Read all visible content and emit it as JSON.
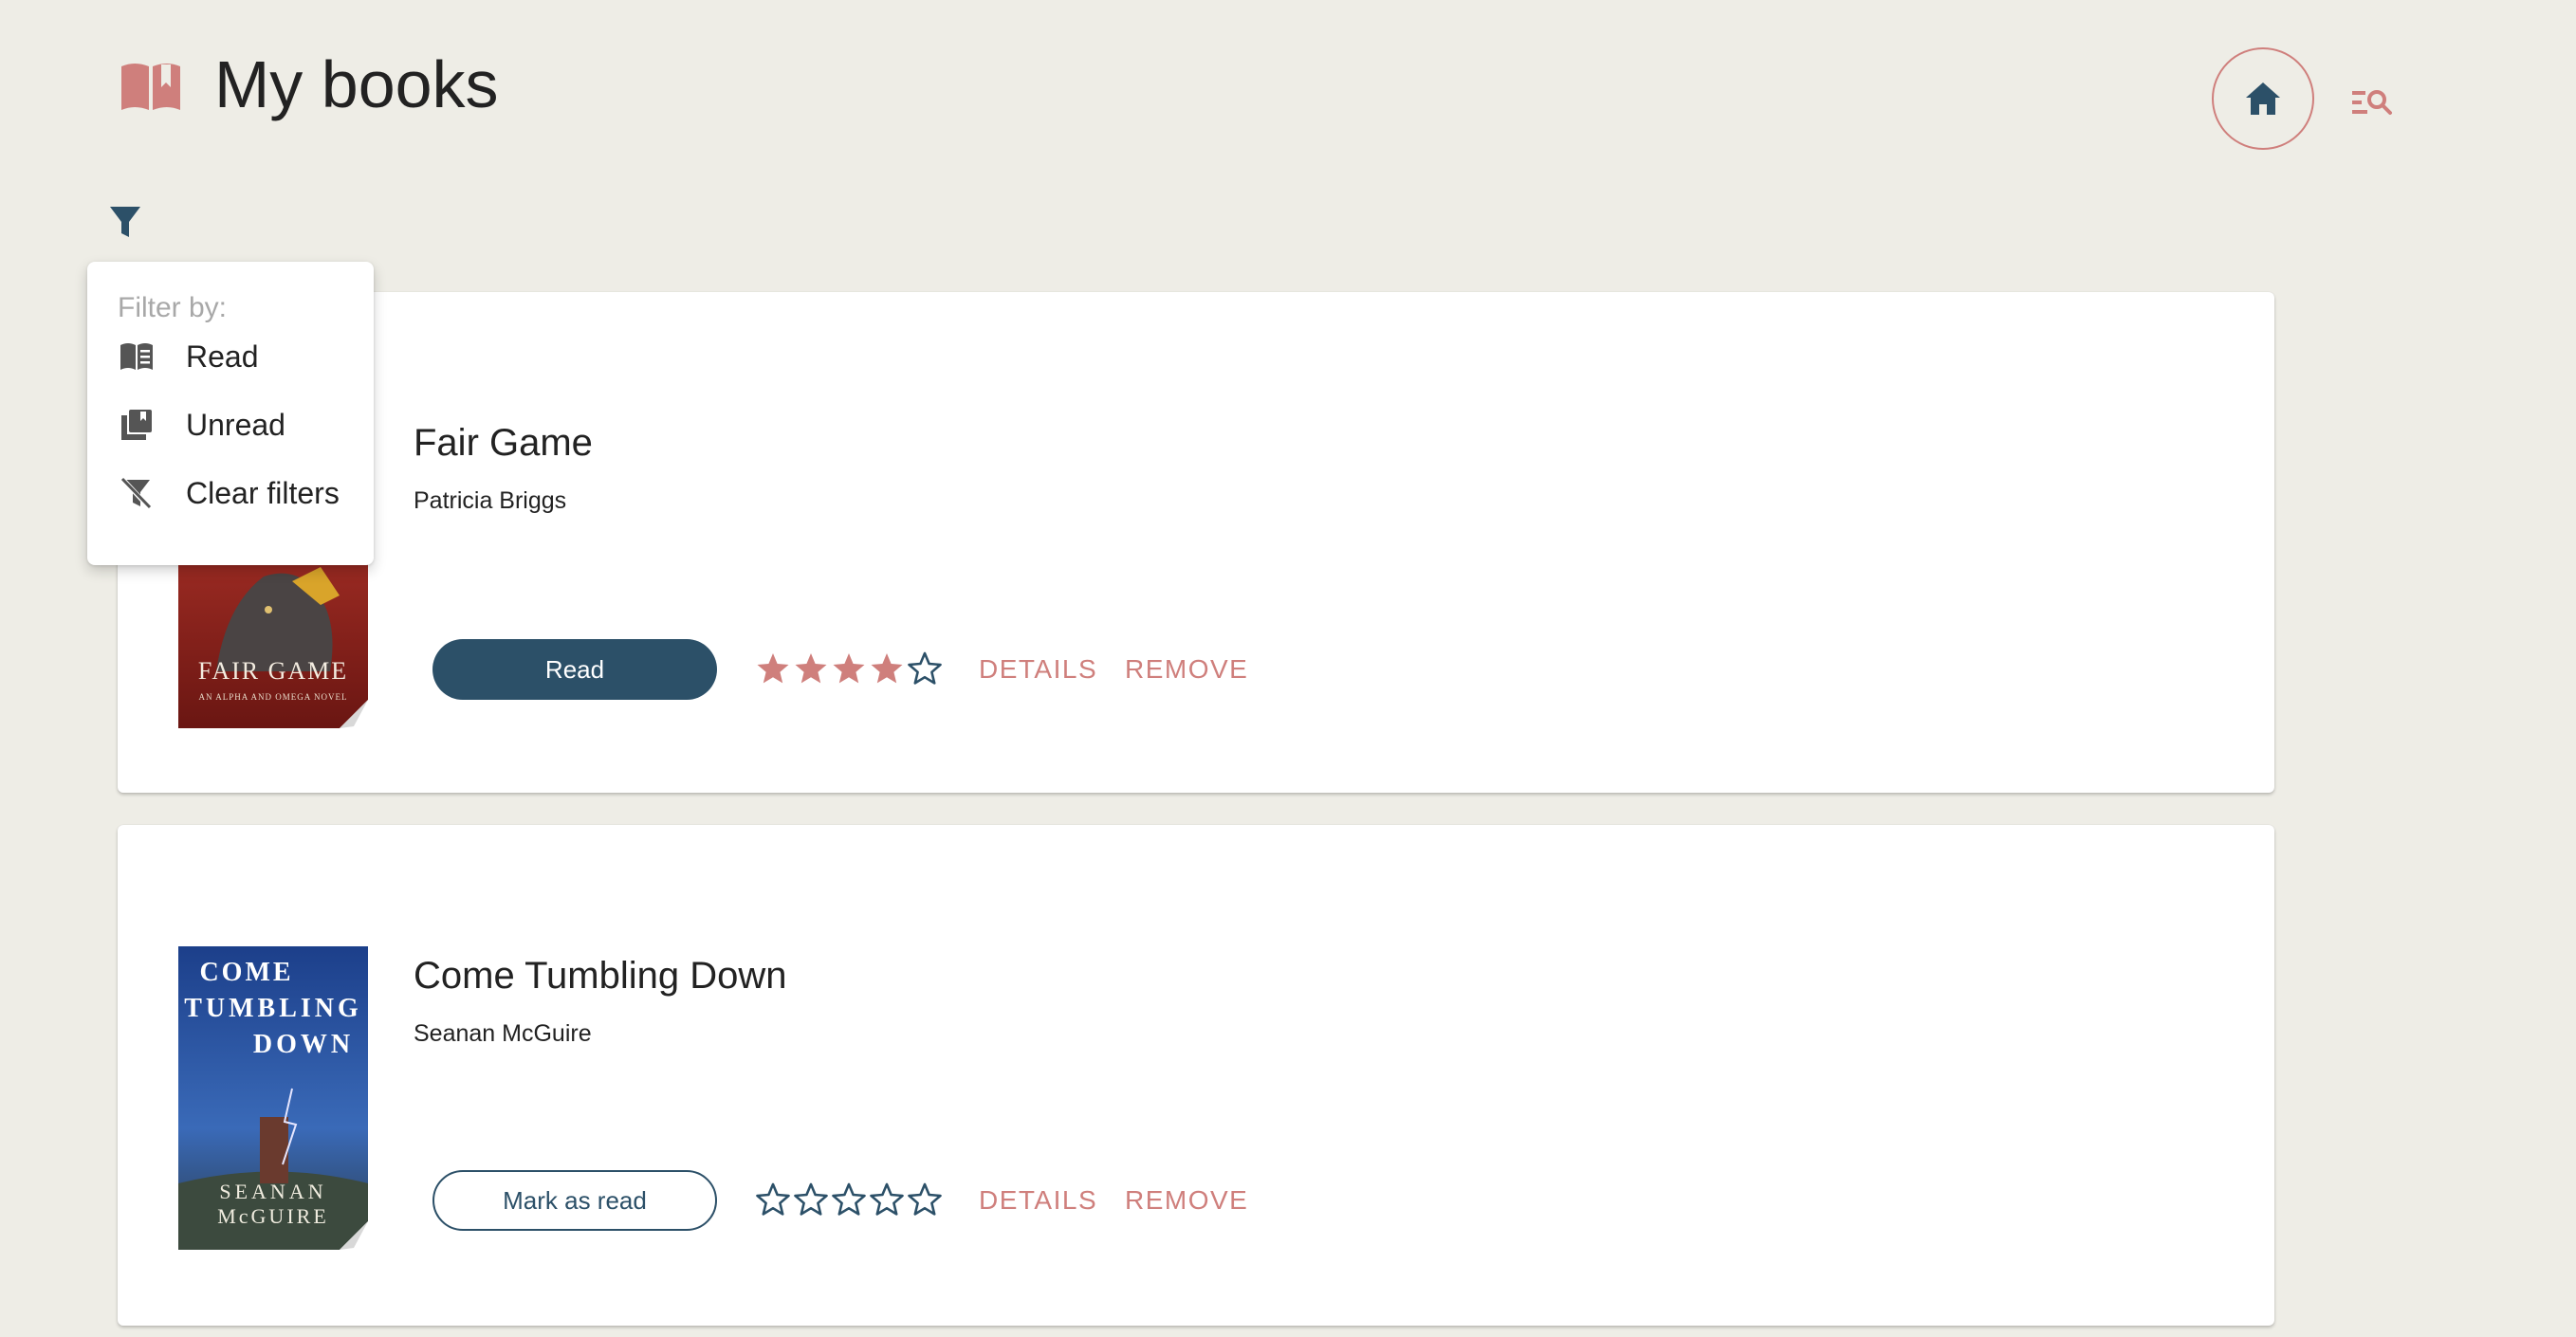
{
  "header": {
    "title": "My books",
    "logo_icon": "open-book-icon",
    "home_icon": "home-icon",
    "search_list_icon": "list-search-icon",
    "accent_color": "#cf7f7c",
    "primary_color": "#2c5068"
  },
  "filter": {
    "icon": "filter-icon",
    "menu": {
      "heading": "Filter by:",
      "items": [
        {
          "label": "Read",
          "icon": "read-book-icon"
        },
        {
          "label": "Unread",
          "icon": "unread-books-icon"
        },
        {
          "label": "Clear filters",
          "icon": "filter-off-icon"
        }
      ]
    }
  },
  "books": [
    {
      "title": "Fair Game",
      "author": "Patricia Briggs",
      "status_label": "Read",
      "status_read": true,
      "rating": 4,
      "rating_max": 5,
      "details_label": "DETAILS",
      "remove_label": "REMOVE",
      "cover": {
        "title_text": "FAIR GAME",
        "subtitle_text": "AN ALPHA AND OMEGA NOVEL"
      }
    },
    {
      "title": "Come Tumbling Down",
      "author": "Seanan McGuire",
      "status_label": "Mark as read",
      "status_read": false,
      "rating": 0,
      "rating_max": 5,
      "details_label": "DETAILS",
      "remove_label": "REMOVE",
      "cover": {
        "title_lines": [
          "COME",
          "TUMBLING",
          "DOWN"
        ],
        "author_lines": [
          "SEANAN",
          "McGUIRE"
        ]
      }
    }
  ]
}
